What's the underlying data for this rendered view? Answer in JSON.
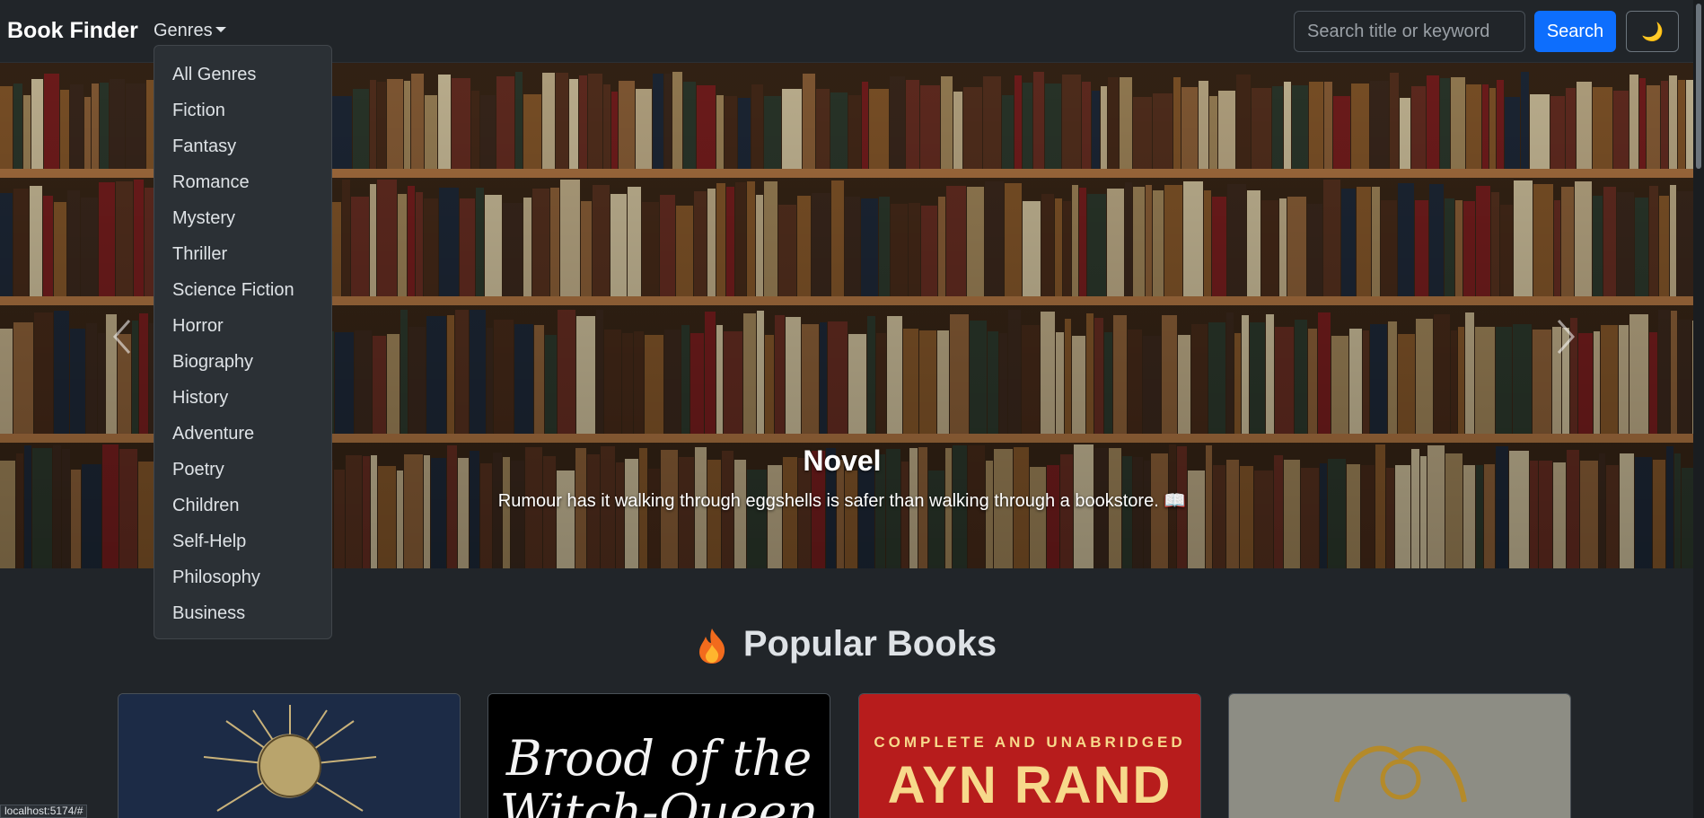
{
  "navbar": {
    "brand": "Book Finder",
    "genres_label": "Genres",
    "search_placeholder": "Search title or keyword",
    "search_button": "Search",
    "theme_icon": "🌙"
  },
  "genres_menu": [
    "All Genres",
    "Fiction",
    "Fantasy",
    "Romance",
    "Mystery",
    "Thriller",
    "Science Fiction",
    "Horror",
    "Biography",
    "History",
    "Adventure",
    "Poetry",
    "Children",
    "Self-Help",
    "Philosophy",
    "Business"
  ],
  "carousel": {
    "title": "Novel",
    "caption": "Rumour has it walking through eggshells is safer than walking through a bookstore. 📖"
  },
  "popular": {
    "title": "Popular Books",
    "cards": [
      {
        "cover_text": ""
      },
      {
        "cover_text": "Brood of the Witch-Queen"
      },
      {
        "cover_banner": "COMPLETE AND UNABRIDGED",
        "cover_author": "AYN RAND"
      },
      {
        "cover_text": ""
      }
    ]
  },
  "status_url": "localhost:5174/#",
  "icons": {
    "theme": "moon-icon",
    "prev": "chevron-left-icon",
    "next": "chevron-right-icon",
    "popular": "flame-icon"
  },
  "colors": {
    "primary": "#0d6efd",
    "background": "#212529"
  }
}
